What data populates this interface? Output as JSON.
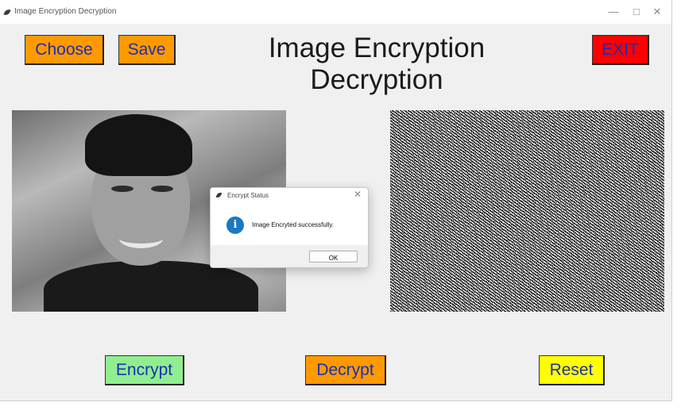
{
  "window": {
    "title": "Image Encryption Decryption",
    "controls": [
      "—",
      "□",
      "✕"
    ]
  },
  "header": {
    "choose_label": "Choose",
    "save_label": "Save",
    "title_line1": "Image Encryption",
    "title_line2": "Decryption",
    "exit_label": "EXIT"
  },
  "footer": {
    "encrypt_label": "Encrypt",
    "decrypt_label": "Decrypt",
    "reset_label": "Reset"
  },
  "dialog": {
    "title": "Encrypt Status",
    "close": "✕",
    "info_glyph": "i",
    "message": "Image Encryted successfully.",
    "ok_label": "OK"
  },
  "colors": {
    "choose_bg": "#ff9900",
    "save_bg": "#ff9900",
    "exit_bg": "#ff0000",
    "encrypt_bg": "#90ee90",
    "decrypt_bg": "#ff9900",
    "reset_bg": "#ffff00",
    "button_text": "#1a2fb3",
    "info_icon": "#1a78c2"
  },
  "icons": {
    "app": "feather-icon",
    "dialog_app": "feather-icon",
    "dialog_info": "info-icon"
  }
}
